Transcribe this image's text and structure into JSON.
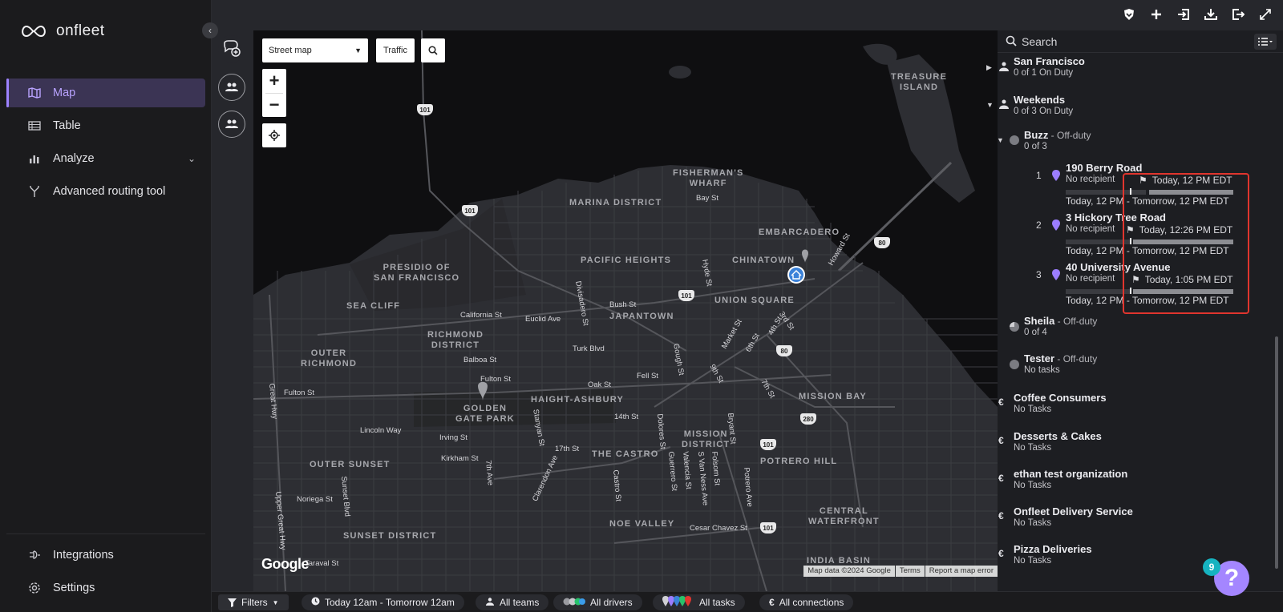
{
  "app": {
    "name": "onfleet"
  },
  "sidebar": {
    "items": [
      {
        "label": "Map",
        "icon": "map-icon",
        "active": true
      },
      {
        "label": "Table",
        "icon": "table-icon"
      },
      {
        "label": "Analyze",
        "icon": "bar-chart-icon"
      },
      {
        "label": "Advanced routing tool",
        "icon": "route-icon"
      }
    ],
    "bottom_items": [
      {
        "label": "Integrations",
        "icon": "plug-icon"
      },
      {
        "label": "Settings",
        "icon": "gear-icon"
      }
    ]
  },
  "map": {
    "map_type": "Street map",
    "traffic_label": "Traffic",
    "google": "Google",
    "attribution": [
      "Map data ©2024 Google",
      "Terms",
      "Report a map error"
    ],
    "areas": [
      "FISHERMAN'S\nWHARF",
      "TREASURE\nISLAND",
      "MARINA DISTRICT",
      "EMBARCADERO",
      "PRESIDIO OF\nSAN FRANCISCO",
      "PACIFIC HEIGHTS",
      "CHINATOWN",
      "SEA CLIFF",
      "UNION SQUARE",
      "JAPANTOWN",
      "RICHMOND\nDISTRICT",
      "OUTER\nRICHMOND",
      "HAIGHT-ASHBURY",
      "GOLDEN\nGATE PARK",
      "MISSION BAY",
      "OUTER SUNSET",
      "MISSION\nDISTRICT",
      "THE CASTRO",
      "POTRERO HILL",
      "NOE VALLEY",
      "CENTRAL\nWATERFRONT",
      "SUNSET DISTRICT",
      "INDIA BASIN"
    ],
    "streets": [
      "Bay St",
      "California St",
      "Bush St",
      "Euclid Ave",
      "Turk Blvd",
      "Balboa St",
      "Fulton St",
      "Oak St",
      "Fell St",
      "Lincoln Way",
      "Irving St",
      "Kirkham St",
      "Noriega St",
      "Taraval St",
      "17th St",
      "14th St",
      "Cesar Chavez St",
      "Divisadero St",
      "Hyde St",
      "Howard St",
      "Market St",
      "3rd St",
      "4th St",
      "6th St",
      "9th St",
      "7th St",
      "Gough St",
      "Stanyan St",
      "Clarendon Ave",
      "Castro St",
      "Dolores St",
      "Guerrero St",
      "Valencia St",
      "S Van Ness Ave",
      "Folsom St",
      "Bryant St",
      "Potrero Ave",
      "Great Hwy",
      "Upper Great Hwy",
      "Sunset Blvd",
      "7th Ave",
      "Fulton St"
    ],
    "highways": [
      "101",
      "101",
      "101",
      "101",
      "101",
      "80",
      "80",
      "280"
    ]
  },
  "bottombar": {
    "filters": "Filters",
    "date_range": "Today 12am - Tomorrow 12am",
    "teams": "All teams",
    "drivers": "All drivers",
    "tasks": "All tasks",
    "connections": "All connections"
  },
  "panel": {
    "search_placeholder": "Search",
    "teams": [
      {
        "name": "San Francisco",
        "status": "0 of 1 On Duty"
      },
      {
        "name": "Weekends",
        "status": "0 of 3 On Duty"
      }
    ],
    "drivers": [
      {
        "name": "Buzz",
        "state": " - Off-duty",
        "count": "0 of 3"
      },
      {
        "name": "Sheila",
        "state": " - Off-duty",
        "count": "0 of 4"
      },
      {
        "name": "Tester",
        "state": " - Off-duty",
        "count": "No tasks"
      }
    ],
    "tasks": [
      {
        "num": "1",
        "address": "190 Berry Road",
        "recipient": "No recipient",
        "eta": "Today, 12 PM EDT",
        "window": "Today, 12 PM - Tomorrow, 12 PM EDT"
      },
      {
        "num": "2",
        "address": "3 Hickory Tree Road",
        "recipient": "No recipient",
        "eta": "Today, 12:26 PM EDT",
        "window": "Today, 12 PM - Tomorrow, 12 PM EDT"
      },
      {
        "num": "3",
        "address": "40 University Avenue",
        "recipient": "No recipient",
        "eta": "Today, 1:05 PM EDT",
        "window": "Today, 12 PM - Tomorrow, 12 PM EDT"
      }
    ],
    "orgs": [
      {
        "name": "Coffee Consumers",
        "status": "No Tasks"
      },
      {
        "name": "Desserts & Cakes",
        "status": "No Tasks"
      },
      {
        "name": "ethan test organization",
        "status": "No Tasks"
      },
      {
        "name": "Onfleet Delivery Service",
        "status": "No Tasks"
      },
      {
        "name": "Pizza Deliveries",
        "status": "No Tasks"
      }
    ]
  },
  "help": {
    "badge": "9",
    "label": "?"
  },
  "colors": {
    "accent": "#9d82ff",
    "highlight": "#e0352e",
    "pin": "#9b7dff"
  }
}
